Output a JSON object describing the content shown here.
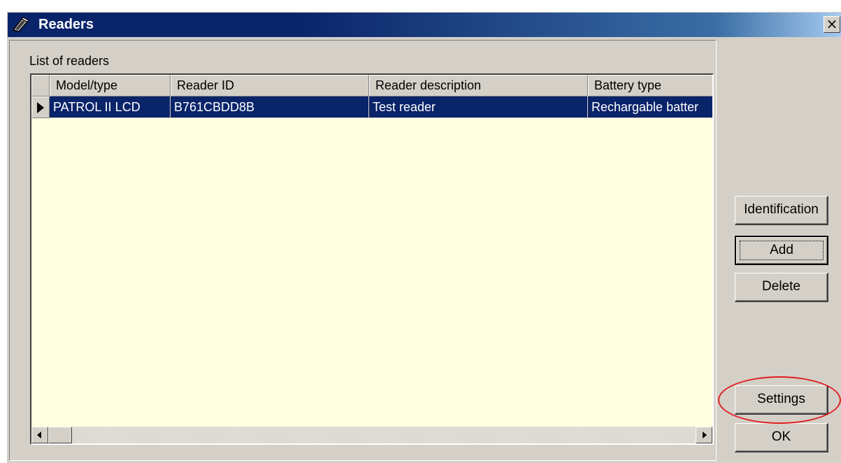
{
  "window": {
    "title": "Readers",
    "close_glyph": "×",
    "icon": "readers-window-icon"
  },
  "list": {
    "label": "List of readers",
    "columns": [
      "Model/type",
      "Reader ID",
      "Reader description",
      "Battery type"
    ],
    "rows": [
      {
        "selected": true,
        "cells": [
          "PATROL II LCD",
          "B761CBDD8B",
          "Test reader",
          "Rechargable batter"
        ]
      }
    ],
    "background": "#ffffe1",
    "selection_color": "#0a246a"
  },
  "buttons": {
    "identification": "Identification",
    "add": "Add",
    "delete": "Delete",
    "settings": "Settings",
    "ok": "OK"
  },
  "annotation": {
    "highlight": "settings-button",
    "color": "#e02020"
  }
}
